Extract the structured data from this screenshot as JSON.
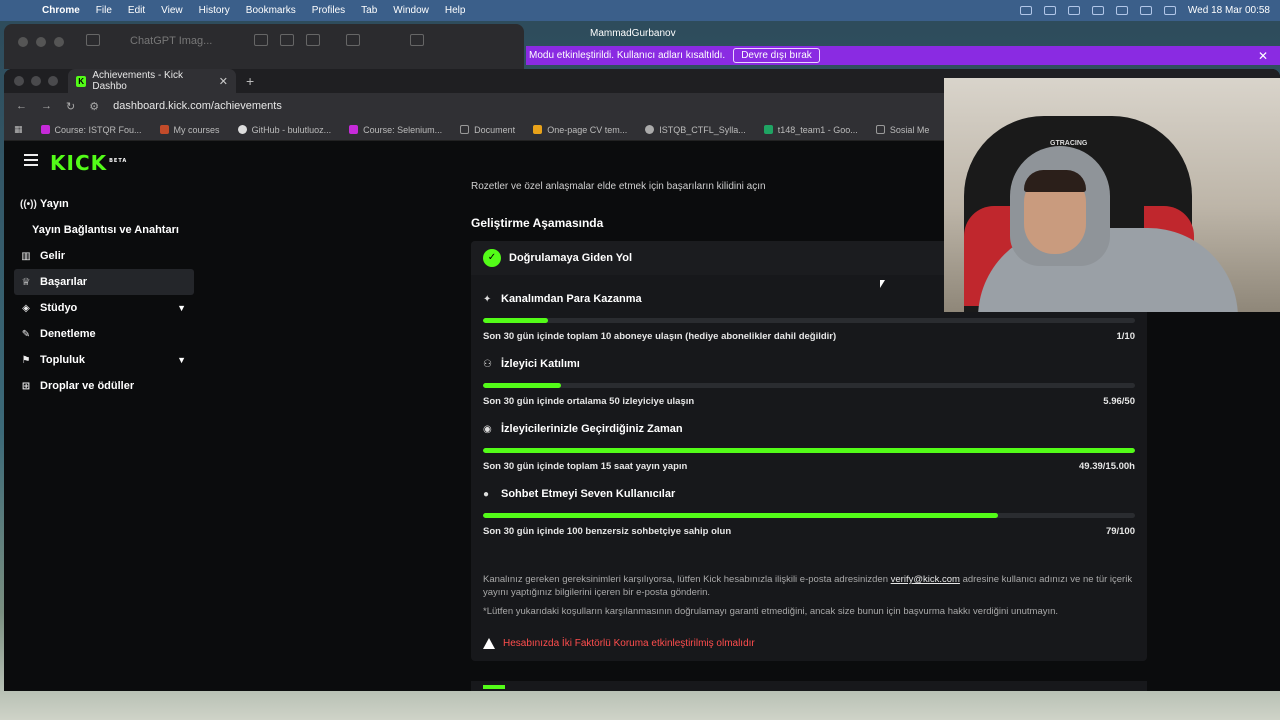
{
  "menubar": {
    "apple": "",
    "app": "Chrome",
    "items": [
      "File",
      "Edit",
      "View",
      "History",
      "Bookmarks",
      "Profiles",
      "Tab",
      "Window",
      "Help"
    ],
    "clock": "Wed 18 Mar  00:58"
  },
  "backwindow": {
    "title": "ChatGPT Imag..."
  },
  "user": {
    "name": "MammadGurbanov"
  },
  "notification": {
    "text": "Modu etkinleştirildi. Kullanıcı adları kısaltıldı.",
    "button": "Devre dışı bırak"
  },
  "browser": {
    "tab_title": "Achievements - Kick Dashbo",
    "url": "dashboard.kick.com/achievements",
    "bookmarks": [
      "Course: ISTQR Fou...",
      "My courses",
      "GitHub - bulutluoz...",
      "Course: Selenium...",
      "Document",
      "One-page CV tem...",
      "ISTQB_CTFL_Sylla...",
      "t148_team1 - Goo...",
      "Sosial Me"
    ]
  },
  "sidebar": {
    "logo": "KICK",
    "logo_tag": "BETA",
    "items": [
      {
        "label": "Yayın"
      },
      {
        "label": "Yayın Bağlantısı ve Anahtarı"
      },
      {
        "label": "Gelir"
      },
      {
        "label": "Başarılar"
      },
      {
        "label": "Stüdyo"
      },
      {
        "label": "Denetleme"
      },
      {
        "label": "Topluluk"
      },
      {
        "label": "Droplar ve ödüller"
      }
    ]
  },
  "main": {
    "intro": "Rozetler ve özel anlaşmalar elde etmek için başarıların kilidini açın",
    "section_title": "Geliştirme Aşamasında",
    "card": {
      "title": "Doğrulamaya Giden Yol",
      "goals": [
        {
          "title": "Kanalımdan Para Kazanma",
          "desc": "Son 30 gün içinde toplam 10 aboneye ulaşın (hediye abonelikler dahil değildir)",
          "value": "1/10",
          "progress": 0.1
        },
        {
          "title": "İzleyici Katılımı",
          "desc": "Son 30 gün içinde ortalama 50 izleyiciye ulaşın",
          "value": "5.96/50",
          "progress": 0.12
        },
        {
          "title": "İzleyicilerinizle Geçirdiğiniz Zaman",
          "desc": "Son 30 gün içinde toplam 15 saat yayın yapın",
          "value": "49.39/15.00h",
          "progress": 1.0
        },
        {
          "title": "Sohbet Etmeyi Seven Kullanıcılar",
          "desc": "Son 30 gün içinde 100 benzersiz sohbetçiye sahip olun",
          "value": "79/100",
          "progress": 0.79
        }
      ],
      "note_before": "Kanalınız gereken gereksinimleri karşılıyorsa, lütfen Kick hesabınızla ilişkili e-posta adresinizden ",
      "note_email": "verify@kick.com",
      "note_after": " adresine kullanıcı adınızı ve ne tür içerik yayını yaptığınız bilgilerini içeren bir e-posta gönderin.",
      "disclaimer": "*Lütfen yukarıdaki koşulların karşılanmasının doğrulamayı garanti etmediğini, ancak size bunun için başvurma hakkı verdiğini unutmayın.",
      "warning": "Hesabınızda İki Faktörlü Koruma etkinleştirilmiş olmalıdır"
    }
  },
  "webcam": {
    "chair_brand": "GTRACING"
  },
  "colors": {
    "accent": "#53fc18",
    "warning": "#ff4d4d",
    "notification": "#8a2be2"
  }
}
